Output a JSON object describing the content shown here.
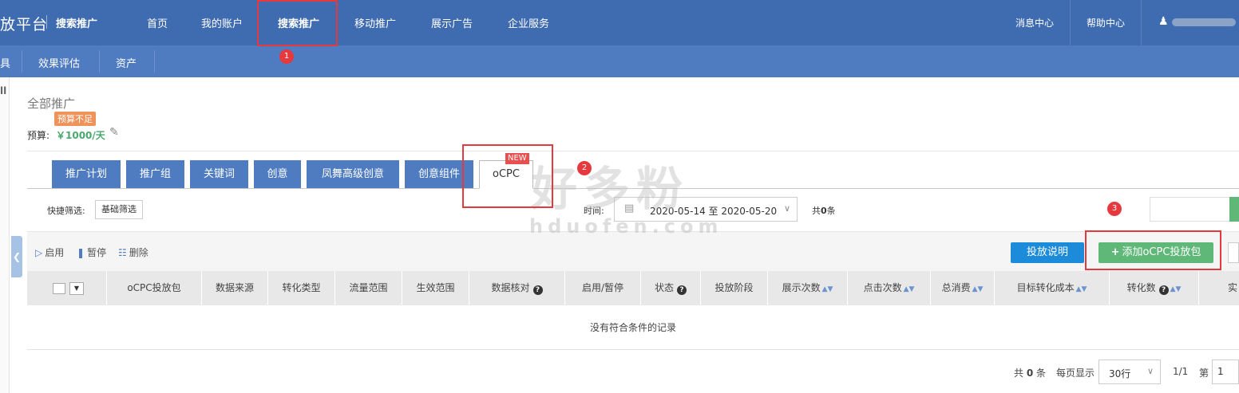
{
  "topbar": {
    "logo": "放平台",
    "product": "搜索推广",
    "nav": [
      "首页",
      "我的账户",
      "搜索推广",
      "移动推广",
      "展示广告",
      "企业服务"
    ],
    "right": [
      "消息中心",
      "帮助中心"
    ]
  },
  "subbar": {
    "items": [
      "具",
      "效果评估",
      "资产"
    ]
  },
  "left_glyph": "ll",
  "header": {
    "title": "全部推广",
    "budget_badge": "预算不足",
    "budget_label": "预算:",
    "budget_value": "￥1000/天"
  },
  "tabs": [
    "推广计划",
    "推广组",
    "关键词",
    "创意",
    "凤舞高级创意",
    "创意组件",
    "oCPC"
  ],
  "new_badge": "NEW",
  "filter": {
    "quick_label": "快捷筛选:",
    "quick_button": "基础筛选",
    "time_label": "时间:",
    "date_range": "2020-05-14 至 2020-05-20",
    "count_prefix": "共",
    "count_value": "0",
    "count_suffix": "条"
  },
  "actions": {
    "enable": "启用",
    "pause": "暂停",
    "delete": "删除",
    "desc_button": "投放说明",
    "add_button": "添加oCPC投放包"
  },
  "table": {
    "columns": [
      "oCPC投放包",
      "数据来源",
      "转化类型",
      "流量范围",
      "生效范围",
      "数据核对",
      "启用/暂停",
      "状态",
      "投放阶段",
      "展示次数",
      "点击次数",
      "总消费",
      "目标转化成本",
      "转化数",
      "实"
    ],
    "empty_text": "没有符合条件的记录"
  },
  "pagination": {
    "total_prefix": "共",
    "total_value": "0",
    "total_suffix": "条",
    "per_page_label": "每页显示",
    "per_page_value": "30行",
    "page_indicator": "1/1",
    "page_label": "第",
    "page_value": "1"
  },
  "annotations": [
    "1",
    "2",
    "3"
  ],
  "watermark": {
    "cn": "好多粉",
    "en": "hduofen.com"
  },
  "colors": {
    "nav": "#3f6bb0",
    "subnav": "#4f7cc1",
    "tab": "#4f7cc1",
    "primary_button": "#1c8bd9",
    "add_button": "#5fb878",
    "badge": "#f0935b",
    "annotation": "#e5393d"
  }
}
